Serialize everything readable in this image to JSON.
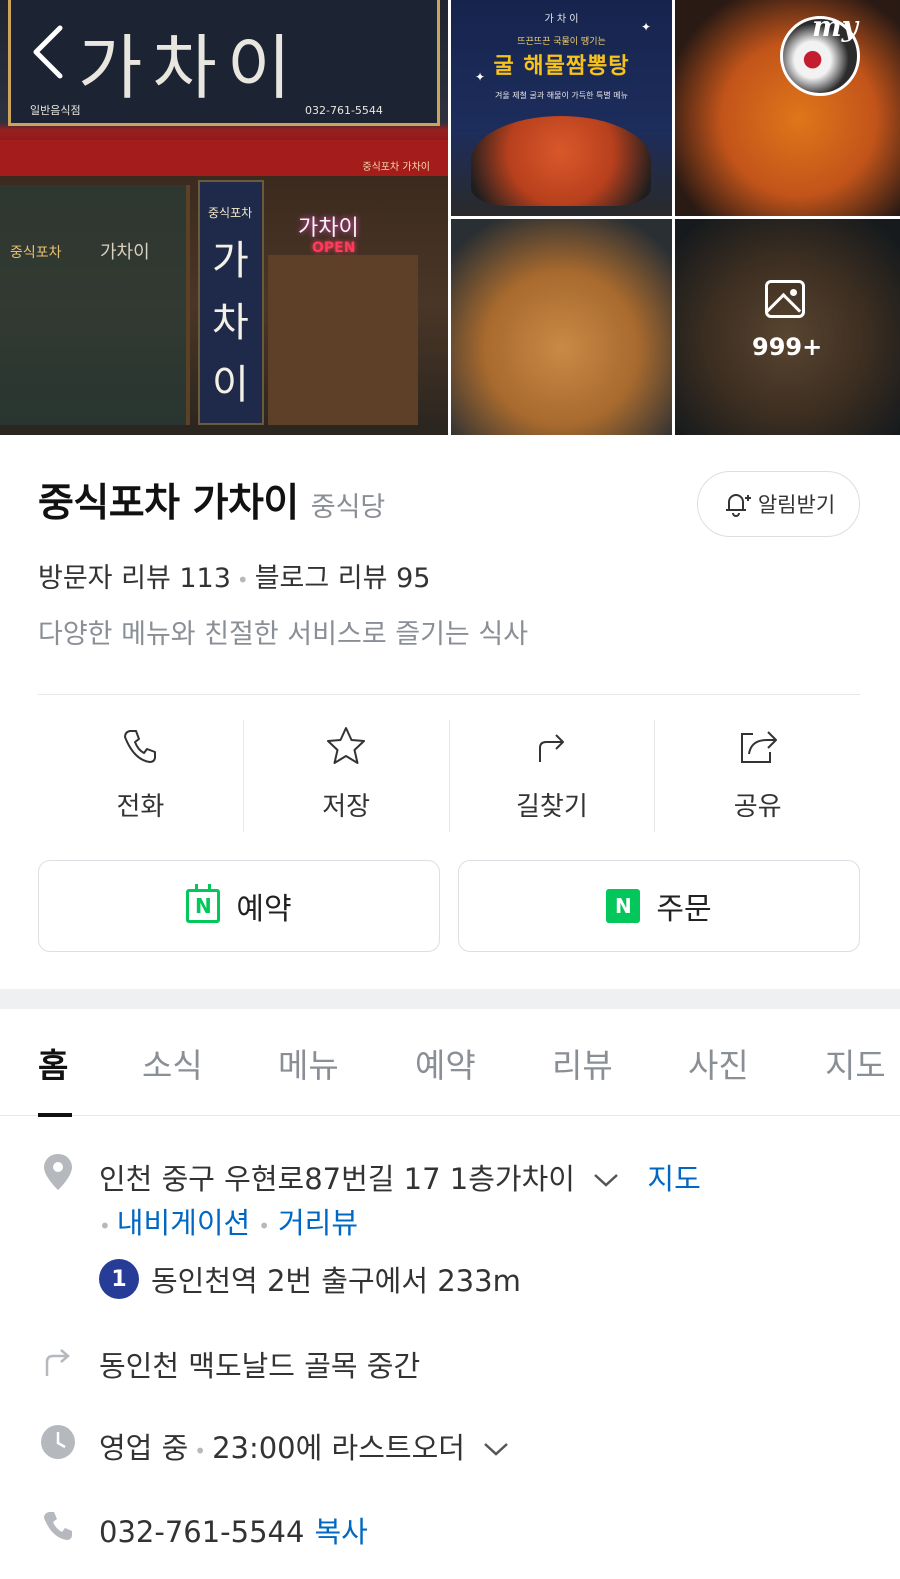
{
  "photos": {
    "main": {
      "sign_big": "가차이",
      "sign_left": "일반음식점",
      "sign_phone": "032-761-5544",
      "awning_text": "중식포차 가차이",
      "vertical_small": "중식포차",
      "vertical_big": "가차이",
      "neon": "가차이",
      "open": "OPEN",
      "glass_text": "중식포차",
      "glass_text2": "가차이"
    },
    "poster": {
      "top": "가 차 이",
      "sub": "뜨끈뜨끈 국물이 땡기는",
      "title": "굴 해물짬뽕탕",
      "desc": "겨울 제철 굴과 해물이 가득한 특별 메뉴"
    },
    "my_badge": "my",
    "more_count": "999+"
  },
  "place": {
    "name": "중식포차 가차이",
    "category": "중식당",
    "notify_label": "알림받기",
    "visitor_reviews": "방문자 리뷰 113",
    "blog_reviews": "블로그 리뷰 95",
    "tagline": "다양한 메뉴와 친절한 서비스로 즐기는 식사"
  },
  "actions": {
    "call": "전화",
    "save": "저장",
    "directions": "길찾기",
    "share": "공유"
  },
  "buttons": {
    "reserve": "예약",
    "order": "주문",
    "badge_letter": "N"
  },
  "tabs": [
    "홈",
    "소식",
    "메뉴",
    "예약",
    "리뷰",
    "사진",
    "지도"
  ],
  "details": {
    "address": "인천 중구 우현로87번길 17 1층가차이",
    "map_link": "지도",
    "navigation_link": "내비게이션",
    "street_view_link": "거리뷰",
    "subway_line": "1",
    "subway_text": "동인천역 2번 출구에서 233m",
    "directions_text": "동인천 맥도날드 골목 중간",
    "status": "영업 중",
    "last_order": "23:00에 라스트오더",
    "phone": "032-761-5544",
    "copy_label": "복사"
  },
  "colors": {
    "naver_green": "#03c75a",
    "link_blue": "#0068c3",
    "subway_line1": "#263c96"
  }
}
